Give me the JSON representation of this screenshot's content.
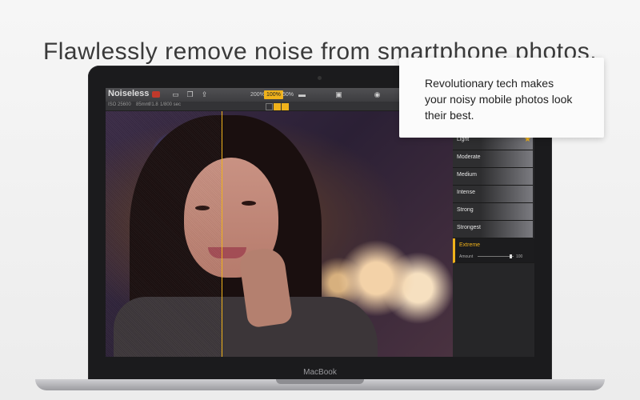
{
  "headline": "Flawlessly remove noise from smartphone photos.",
  "callout": {
    "text": "Revolutionary tech makes\nyour noisy mobile photos look\ntheir best."
  },
  "device": {
    "brand": "MacBook"
  },
  "app": {
    "name": "Noiseless",
    "toolbar": {
      "icons": [
        "open-icon",
        "copy-icon",
        "share-icon",
        "fit-icon",
        "compare-icon",
        "eye-icon"
      ],
      "zoom_options": [
        "200%",
        "100%",
        "50%"
      ],
      "active_zoom": "100%"
    },
    "info": {
      "iso": "ISO 25600",
      "focal": "85mm",
      "aperture": "f/1.8",
      "shutter": "1/800 sec"
    },
    "presets": [
      {
        "label": "Light"
      },
      {
        "label": "Moderate"
      },
      {
        "label": "Medium"
      },
      {
        "label": "Intense"
      },
      {
        "label": "Strong"
      },
      {
        "label": "Strongest"
      },
      {
        "label": "Extreme"
      }
    ],
    "active_preset": "Extreme",
    "amount": {
      "label": "Amount",
      "value": "100"
    }
  },
  "colors": {
    "accent": "#f0b21b",
    "toolbar": "#454548",
    "panel": "#262628"
  }
}
